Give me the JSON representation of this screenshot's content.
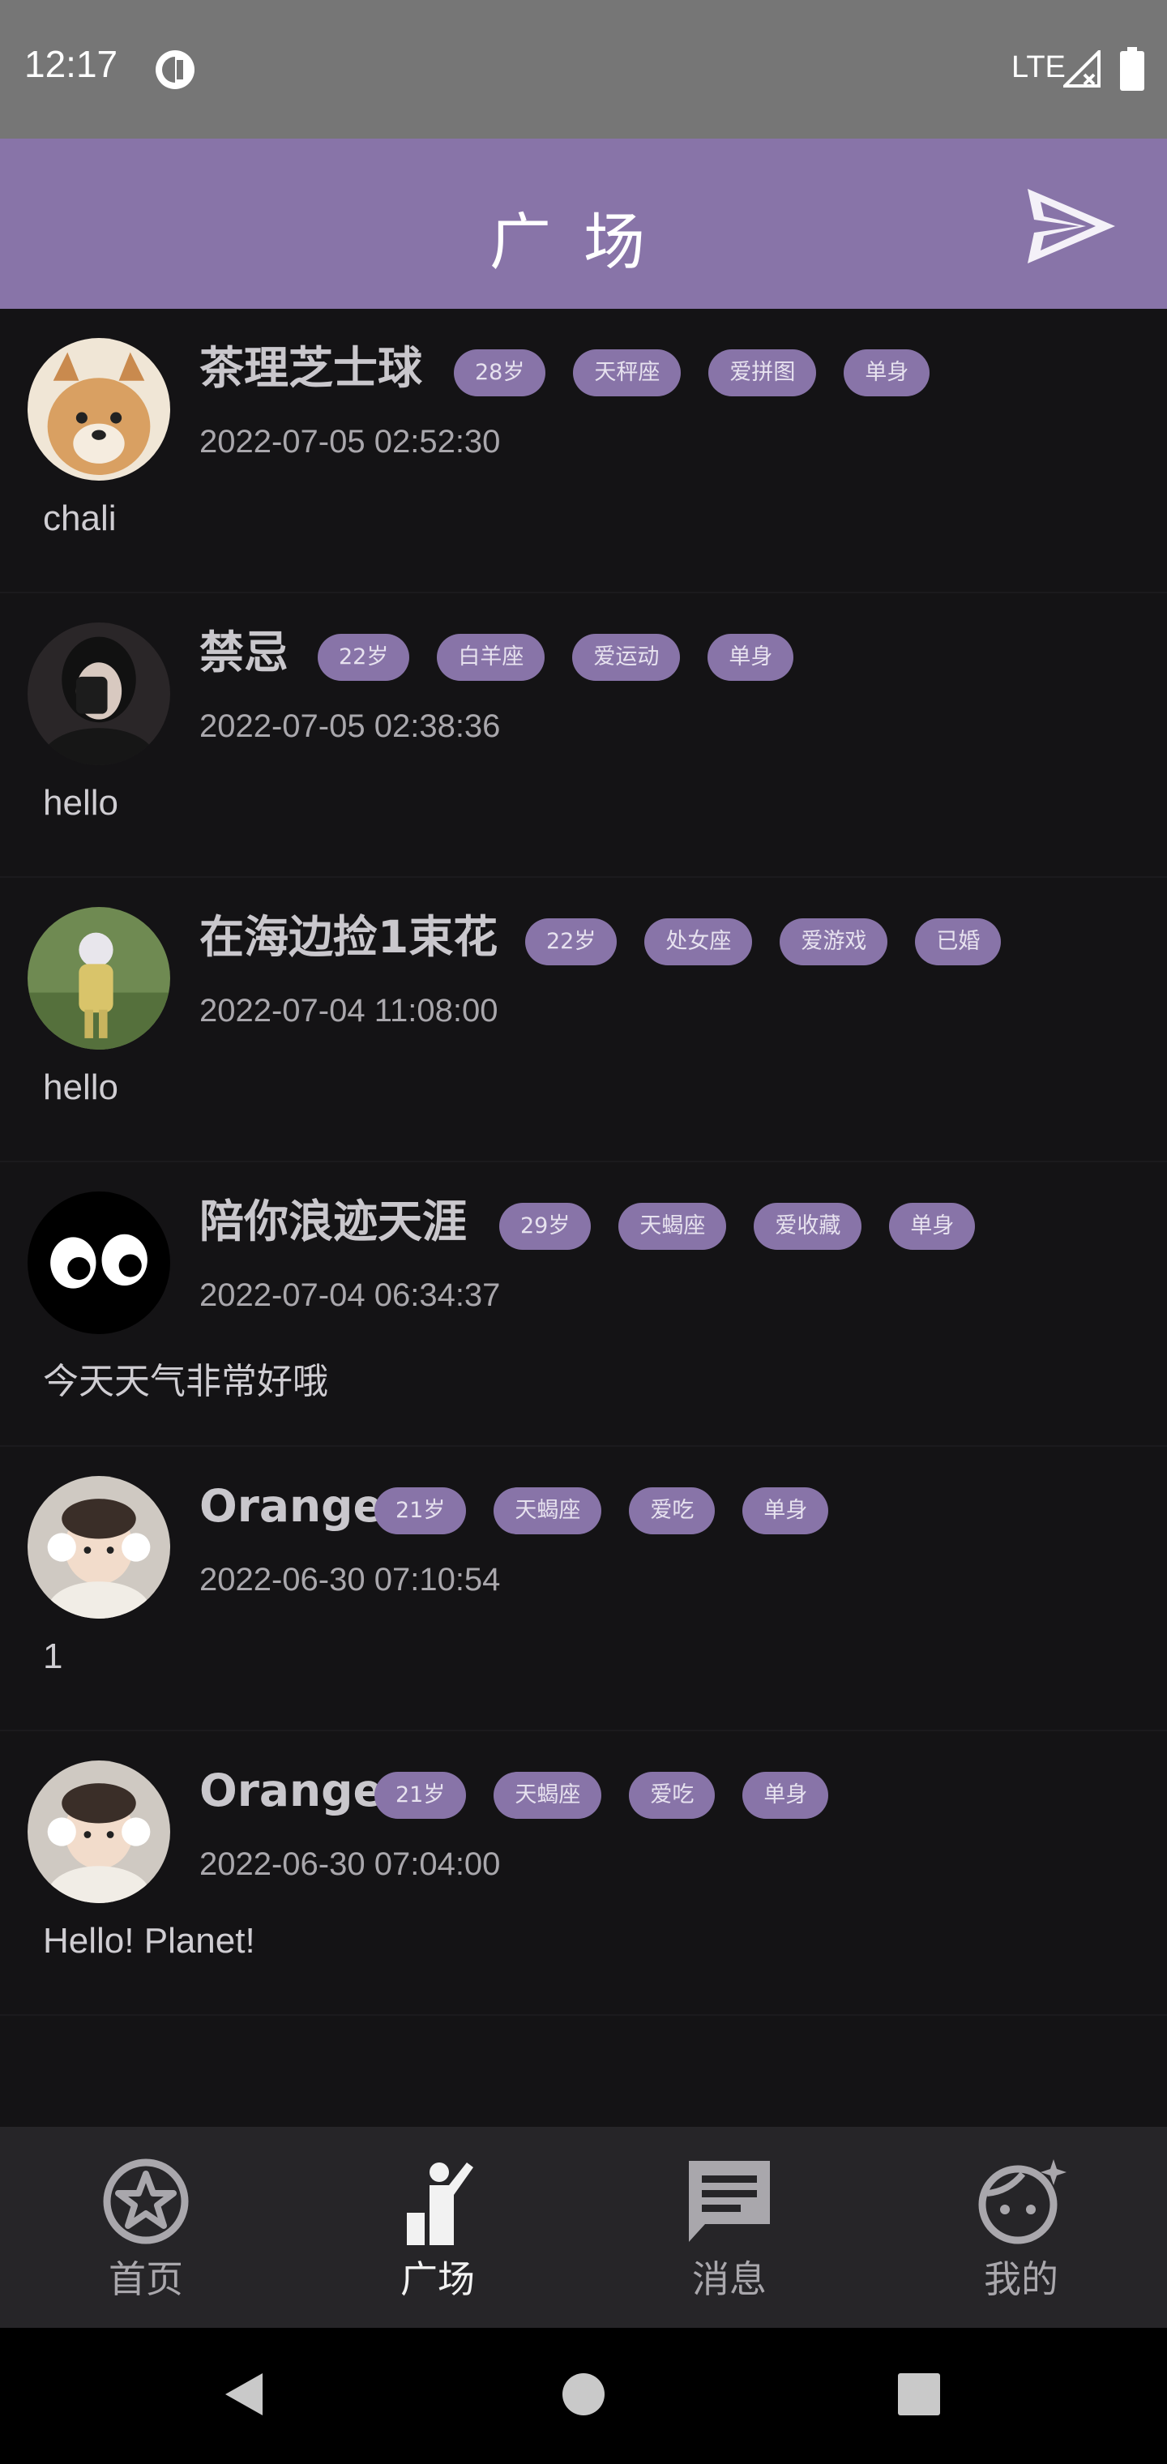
{
  "status_bar": {
    "time": "12:17",
    "network": "LTE"
  },
  "header": {
    "title": "广场"
  },
  "posts": [
    {
      "name": "茶理芝士球",
      "tags": [
        "28岁",
        "天秤座",
        "爱拼图",
        "单身"
      ],
      "time": "2022-07-05 02:52:30",
      "content": "chali"
    },
    {
      "name": "禁忌",
      "tags": [
        "22岁",
        "白羊座",
        "爱运动",
        "单身"
      ],
      "time": "2022-07-05 02:38:36",
      "content": "hello"
    },
    {
      "name": "在海边捡1束花",
      "tags": [
        "22岁",
        "处女座",
        "爱游戏",
        "已婚"
      ],
      "time": "2022-07-04 11:08:00",
      "content": "hello"
    },
    {
      "name": "陪你浪迹天涯",
      "tags": [
        "29岁",
        "天蝎座",
        "爱收藏",
        "单身"
      ],
      "time": "2022-07-04 06:34:37",
      "content": "今天天气非常好哦"
    },
    {
      "name": "Orange",
      "tags": [
        "21岁",
        "天蝎座",
        "爱吃",
        "单身"
      ],
      "time": "2022-06-30 07:10:54",
      "content": "1"
    },
    {
      "name": "Orange",
      "tags": [
        "21岁",
        "天蝎座",
        "爱吃",
        "单身"
      ],
      "time": "2022-06-30 07:04:00",
      "content": "Hello! Planet!"
    }
  ],
  "bottom_nav": [
    {
      "label": "首页",
      "icon": "star-badge-icon"
    },
    {
      "label": "广场",
      "icon": "person-podium-icon"
    },
    {
      "label": "消息",
      "icon": "chat-message-icon"
    },
    {
      "label": "我的",
      "icon": "smiley-face-icon"
    }
  ],
  "colors": {
    "accent": "#8874a8",
    "background": "#141315"
  }
}
